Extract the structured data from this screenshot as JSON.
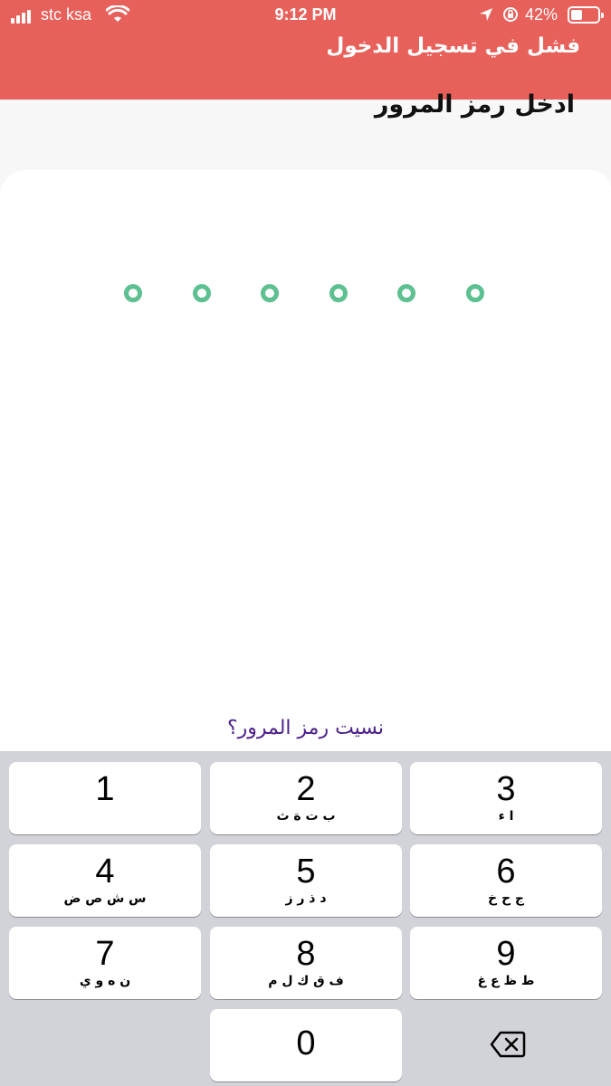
{
  "status_bar": {
    "carrier": "stc ksa",
    "time": "9:12 PM",
    "battery_percent": "42%",
    "battery_level": 0.42
  },
  "header": {
    "title": "فشل في تسجيل الدخول"
  },
  "subtitle": "ادخل رمز المرور",
  "passcode": {
    "length": 6,
    "entered": 0
  },
  "forgot_link": "نسيت رمز المرور؟",
  "keypad": {
    "keys": [
      {
        "num": "1",
        "letters": ""
      },
      {
        "num": "2",
        "letters": "ب ت ة ث"
      },
      {
        "num": "3",
        "letters": "ا ء"
      },
      {
        "num": "4",
        "letters": "س ش ص ض"
      },
      {
        "num": "5",
        "letters": "د ذ ر ز"
      },
      {
        "num": "6",
        "letters": "ج ح خ"
      },
      {
        "num": "7",
        "letters": "ن ه و ي"
      },
      {
        "num": "8",
        "letters": "ف ق ك ل م"
      },
      {
        "num": "9",
        "letters": "ط ظ ع غ"
      },
      {
        "num": "0",
        "letters": ""
      }
    ],
    "backspace_icon": "backspace-icon"
  },
  "colors": {
    "header_bg": "#e8605a",
    "dot_ring": "#5cc090",
    "link": "#4b1f8a",
    "keypad_bg": "#d2d3d8"
  }
}
